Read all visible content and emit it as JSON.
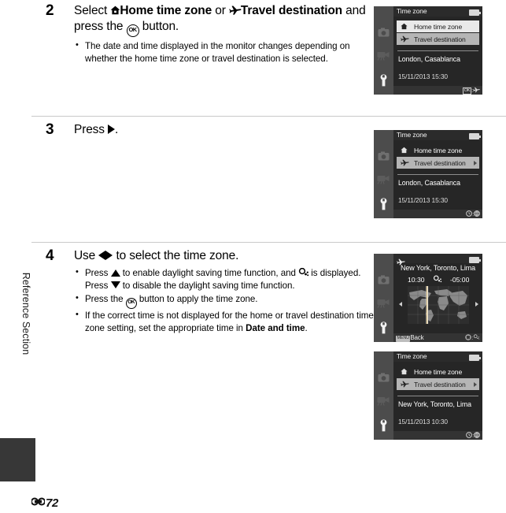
{
  "page": {
    "side_label": "Reference Section",
    "page_marker": "72",
    "page_marker_icon": "e-reference-mark"
  },
  "steps": [
    {
      "number": "2",
      "head_parts": [
        {
          "t": "Select ",
          "bold": false
        },
        {
          "t": "home-icon",
          "icon": true
        },
        {
          "t": " Home time zone ",
          "bold": true
        },
        {
          "t": "or ",
          "bold": false
        },
        {
          "t": "plane-icon",
          "icon": true
        },
        {
          "t": " Travel destination ",
          "bold": true
        },
        {
          "t": "and press the ",
          "bold": false
        },
        {
          "t": "ok-icon",
          "icon": true
        },
        {
          "t": " button.",
          "bold": false
        }
      ],
      "head_plain": "Select  Home time zone or  Travel destination and press the OK button.",
      "bullets": [
        "The date and time displayed in the monitor changes depending on whether the home time zone or travel destination is selected."
      ]
    },
    {
      "number": "3",
      "head_plain": "Press .",
      "bullets": []
    },
    {
      "number": "4",
      "head_plain": "Use  to select the time zone.",
      "bullets": [
        "Press  to enable daylight saving time function, and  is displayed. Press  to disable the daylight saving time function.",
        "Press the  button to apply the time zone.",
        "If the correct time is not displayed for the home or travel destination time zone setting, set the appropriate time in Date and time."
      ]
    }
  ],
  "text": {
    "select": "Select ",
    "home_time_zone": "Home time zone",
    "or": " or ",
    "travel_destination": "Travel destination",
    "and_press_the": " and press the ",
    "button_period": " button.",
    "step2_bullet1": "The date and time displayed in the monitor changes depending on whether the home time zone or travel destination is selected.",
    "press": "Press ",
    "period": ".",
    "use": "Use ",
    "to_select_tz": " to select the time zone.",
    "b1_a": "Press ",
    "b1_b": " to enable daylight saving time function, and ",
    "b1_c": " is displayed. Press ",
    "b1_d": " to disable the daylight saving time function.",
    "b2_a": "Press the ",
    "b2_b": " button to apply the time zone.",
    "b3_a": "If the correct time is not displayed for the home or travel destination time zone setting, set the appropriate time in ",
    "b3_bold": "Date and time",
    "b3_end": "."
  },
  "screens": [
    {
      "id": "screen-step2",
      "title": "Time zone",
      "rows": [
        {
          "label": "Home time zone",
          "icon": "home-icon",
          "state": "selected-light",
          "arrow": false
        },
        {
          "label": "Travel destination",
          "icon": "plane-icon",
          "state": "selected-grey",
          "arrow": false
        }
      ],
      "city": "London, Casablanca",
      "datetime": "15/11/2013  15:30",
      "bottom_right_ok": "OK",
      "bottom_right_sep": ":",
      "bottom_right_icon": "plane-icon"
    },
    {
      "id": "screen-step3",
      "title": "Time zone",
      "rows": [
        {
          "label": "Home time zone",
          "icon": "home-icon",
          "state": "normal",
          "arrow": false
        },
        {
          "label": "Travel destination",
          "icon": "plane-icon",
          "state": "selected-grey",
          "arrow": true
        }
      ],
      "city": "London, Casablanca",
      "datetime": "15/11/2013  15:30",
      "bottom_right_icon_left": "clock-icon",
      "bottom_right_sep": ":",
      "bottom_right_icon_right": "globe-icon"
    },
    {
      "id": "screen-step4-map",
      "header_icon": "plane-icon",
      "city": "New York, Toronto, Lima",
      "time": "10:30",
      "dst_icon": "dst-icon",
      "utc_offset": "-05:00",
      "back_label": "Back",
      "back_chip": "MENU",
      "bottom_right_icon_left": "multi-selector-icon",
      "bottom_right_sep": ":",
      "bottom_right_icon_right": "dst-icon"
    },
    {
      "id": "screen-step4-result",
      "title": "Time zone",
      "rows": [
        {
          "label": "Home time zone",
          "icon": "home-icon",
          "state": "normal",
          "arrow": false
        },
        {
          "label": "Travel destination",
          "icon": "plane-icon",
          "state": "selected-grey",
          "arrow": true
        }
      ],
      "city": "New York, Toronto, Lima",
      "datetime": "15/11/2013  10:30",
      "bottom_right_icon_left": "clock-icon",
      "bottom_right_sep": ":",
      "bottom_right_icon_right": "globe-icon"
    }
  ],
  "colors": {
    "screen_bg": "#262626",
    "sidebar": "#4c4c4c",
    "row_selected_light": "#e9e9e9",
    "row_selected_grey": "#b5b5b5",
    "rule": "#c9c9c9",
    "tab": "#373737"
  }
}
